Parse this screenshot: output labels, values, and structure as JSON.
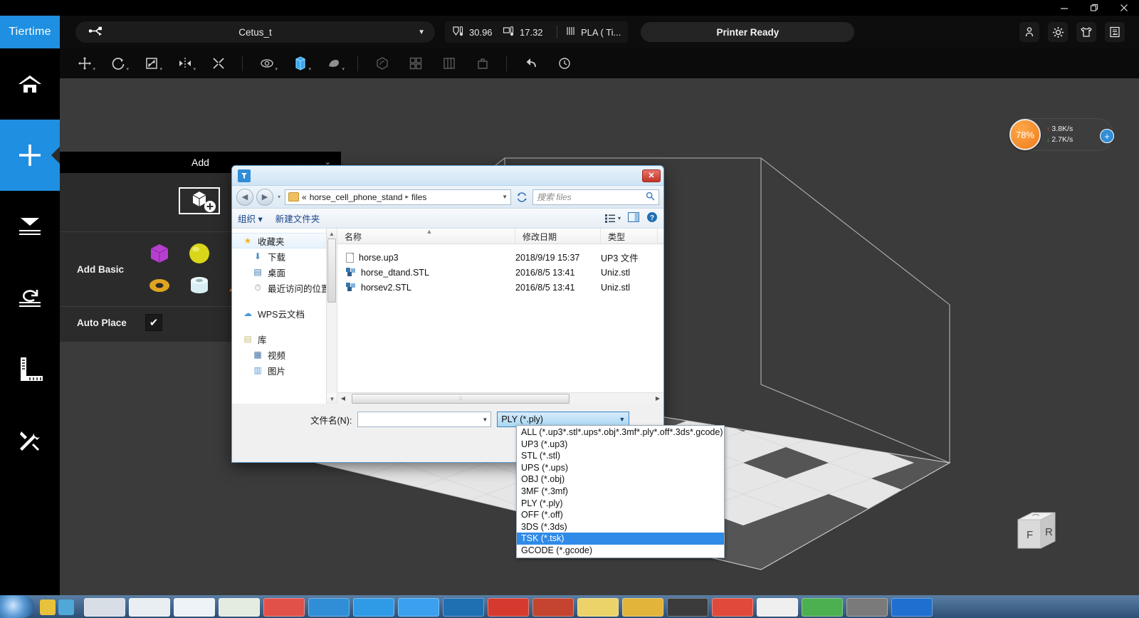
{
  "os_window": {
    "buttons": [
      {
        "name": "minimize-button",
        "glyph": "minimize"
      },
      {
        "name": "restore-button",
        "glyph": "restore"
      },
      {
        "name": "close-button",
        "glyph": "close"
      }
    ]
  },
  "app_header": {
    "brand": "Tiertime",
    "printer_selector": {
      "icon": "usb-icon",
      "value": "Cetus_t",
      "caret": "▼"
    },
    "status": {
      "nozzle_icon": "nozzle-temperature-icon",
      "nozzle_temp": "30.96",
      "bed_icon": "bed-temperature-icon",
      "bed_temp": "17.32",
      "material_icon": "material-spool-icon",
      "material": "PLA ( Ti..."
    },
    "printer_state": "Printer Ready",
    "right_icons": [
      {
        "name": "user-account-icon",
        "label": "user"
      },
      {
        "name": "gear-icon",
        "label": "settings"
      },
      {
        "name": "shirt-icon",
        "label": "theme"
      },
      {
        "name": "print-preview-icon",
        "label": "print-preview"
      }
    ]
  },
  "rail": {
    "items": [
      {
        "name": "sidebar-item-home",
        "icon": "home-icon",
        "active": false
      },
      {
        "name": "sidebar-item-add",
        "icon": "plus-icon",
        "active": true
      },
      {
        "name": "sidebar-item-print",
        "icon": "print-layer-icon",
        "active": false
      },
      {
        "name": "sidebar-item-history",
        "icon": "rotate-undo-icon",
        "active": false
      },
      {
        "name": "sidebar-item-measure",
        "icon": "ruler-icon",
        "active": false
      },
      {
        "name": "sidebar-item-maintenance",
        "icon": "tools-icon",
        "active": false
      }
    ]
  },
  "toolbar": {
    "items": [
      {
        "name": "move-tool",
        "icon": "move-icon",
        "state": "normal"
      },
      {
        "name": "rotate-tool",
        "icon": "rotate-icon",
        "state": "normal"
      },
      {
        "name": "scale-tool",
        "icon": "scale-icon",
        "state": "normal"
      },
      {
        "name": "mirror-tool",
        "icon": "mirror-icon",
        "state": "normal"
      },
      {
        "name": "merge-tool",
        "icon": "merge-icon",
        "state": "normal"
      },
      {
        "name": "view-visibility-tool",
        "icon": "eye-icon",
        "state": "normal"
      },
      {
        "name": "solid-view-tool",
        "icon": "solid-cube-icon",
        "state": "active"
      },
      {
        "name": "shell-view-tool",
        "icon": "shell-icon",
        "state": "normal"
      },
      {
        "name": "slice-preview-tool",
        "icon": "slice-icon",
        "state": "dim"
      },
      {
        "name": "grid-layout-tool",
        "icon": "grid-icon",
        "state": "dim"
      },
      {
        "name": "column-layout-tool",
        "icon": "columns-icon",
        "state": "dim"
      },
      {
        "name": "basket-tool",
        "icon": "basket-icon",
        "state": "dim"
      },
      {
        "name": "undo-tool",
        "icon": "undo-arrow-icon",
        "state": "normal"
      },
      {
        "name": "redo-tool",
        "icon": "reset-view-icon",
        "state": "normal"
      }
    ]
  },
  "add_panel": {
    "title": "Add",
    "collapse_icon": "chevron-down-icon",
    "hero_icon": "add-model-icon",
    "add_basic_label": "Add Basic",
    "shapes": [
      {
        "name": "shape-cube",
        "color": "#b63fd0"
      },
      {
        "name": "shape-sphere",
        "color": "#d9d619"
      },
      {
        "name": "shape-cylinder",
        "color": "#3a44e0"
      },
      {
        "name": "shape-torus",
        "color": "#e0a520"
      },
      {
        "name": "shape-tube",
        "color": "#d8eef2"
      },
      {
        "name": "shape-wedge",
        "color": "#ef8b2e"
      }
    ],
    "auto_place_label": "Auto Place",
    "auto_place_checked": "✔"
  },
  "network_widget": {
    "percent": "78%",
    "up_arrow": "↑",
    "up_rate": "3.8K/s",
    "down_arrow": "↓",
    "down_rate": "2.7K/s",
    "add_button": "+"
  },
  "view_cube": {
    "front_label": "F",
    "right_label": "R"
  },
  "file_dialog": {
    "app_icon": "tiertime-app-icon",
    "close_label": "✕",
    "nav": {
      "back_icon": "back-arrow-icon",
      "forward_icon": "forward-arrow-icon",
      "history_caret": "▾",
      "breadcrumb_sep": "«",
      "crumb_1": "horse_cell_phone_stand",
      "crumb_arrow": "▸",
      "crumb_2": "files",
      "crumb_dropdown": "▼",
      "refresh_icon": "refresh-icon",
      "search_placeholder": "搜索 files",
      "search_icon": "search-icon"
    },
    "commandbar": {
      "organize": "组织 ▾",
      "new_folder": "新建文件夹",
      "view_icon": "view-mode-icon",
      "view_caret": "▾",
      "preview_pane_icon": "preview-pane-icon",
      "help_icon": "help-icon"
    },
    "places": [
      {
        "name": "nav-favorites",
        "label": "收藏夹",
        "icon": "star-icon",
        "level": 0,
        "selected": true
      },
      {
        "name": "nav-downloads",
        "label": "下载",
        "icon": "download-icon",
        "level": 1,
        "selected": false
      },
      {
        "name": "nav-desktop",
        "label": "桌面",
        "icon": "desktop-icon",
        "level": 1,
        "selected": false
      },
      {
        "name": "nav-recent-places",
        "label": "最近访问的位置",
        "icon": "recent-icon",
        "level": 1,
        "selected": false
      },
      {
        "name": "nav-gap-1",
        "label": "",
        "icon": "",
        "level": -1,
        "selected": false
      },
      {
        "name": "nav-wps-cloud",
        "label": "WPS云文档",
        "icon": "cloud-icon",
        "level": 0,
        "selected": false
      },
      {
        "name": "nav-gap-2",
        "label": "",
        "icon": "",
        "level": -1,
        "selected": false
      },
      {
        "name": "nav-libraries",
        "label": "库",
        "icon": "library-icon",
        "level": 0,
        "selected": false
      },
      {
        "name": "nav-videos",
        "label": "视频",
        "icon": "video-icon",
        "level": 1,
        "selected": false
      },
      {
        "name": "nav-pictures",
        "label": "图片",
        "icon": "picture-icon",
        "level": 1,
        "selected": false
      }
    ],
    "columns": [
      "名称",
      "修改日期",
      "类型"
    ],
    "files": [
      {
        "name": "horse.up3",
        "date": "2018/9/19 15:37",
        "type": "UP3 文件",
        "icon": "document-icon"
      },
      {
        "name": "horse_dtand.STL",
        "date": "2016/8/5 13:41",
        "type": "Uniz.stl",
        "icon": "stl-model-icon"
      },
      {
        "name": "horsev2.STL",
        "date": "2016/8/5 13:41",
        "type": "Uniz.stl",
        "icon": "stl-model-icon"
      }
    ],
    "footer": {
      "filename_label": "文件名(N):",
      "filename_value": "",
      "filename_caret": "▼",
      "filetype_value": "PLY (*.ply)",
      "filetype_caret": "▼"
    },
    "filetype_options": [
      {
        "label": "ALL (*.up3*.stl*.ups*.obj*.3mf*.ply*.off*.3ds*.gcode)",
        "selected": false
      },
      {
        "label": "UP3 (*.up3)",
        "selected": false
      },
      {
        "label": "STL (*.stl)",
        "selected": false
      },
      {
        "label": "UPS (*.ups)",
        "selected": false
      },
      {
        "label": "OBJ (*.obj)",
        "selected": false
      },
      {
        "label": "3MF (*.3mf)",
        "selected": false
      },
      {
        "label": "PLY (*.ply)",
        "selected": false
      },
      {
        "label": "OFF (*.off)",
        "selected": false
      },
      {
        "label": "3DS (*.3ds)",
        "selected": false
      },
      {
        "label": "TSK (*.tsk)",
        "selected": true
      },
      {
        "label": "GCODE (*.gcode)",
        "selected": false
      }
    ]
  },
  "colors": {
    "brand_blue": "#1e8fe1",
    "highlight_blue": "#2f8ae8",
    "viewport_gray": "#3b3b3b",
    "panel_gray": "#2b2b2b",
    "accent_orange": "#ef7a18"
  }
}
